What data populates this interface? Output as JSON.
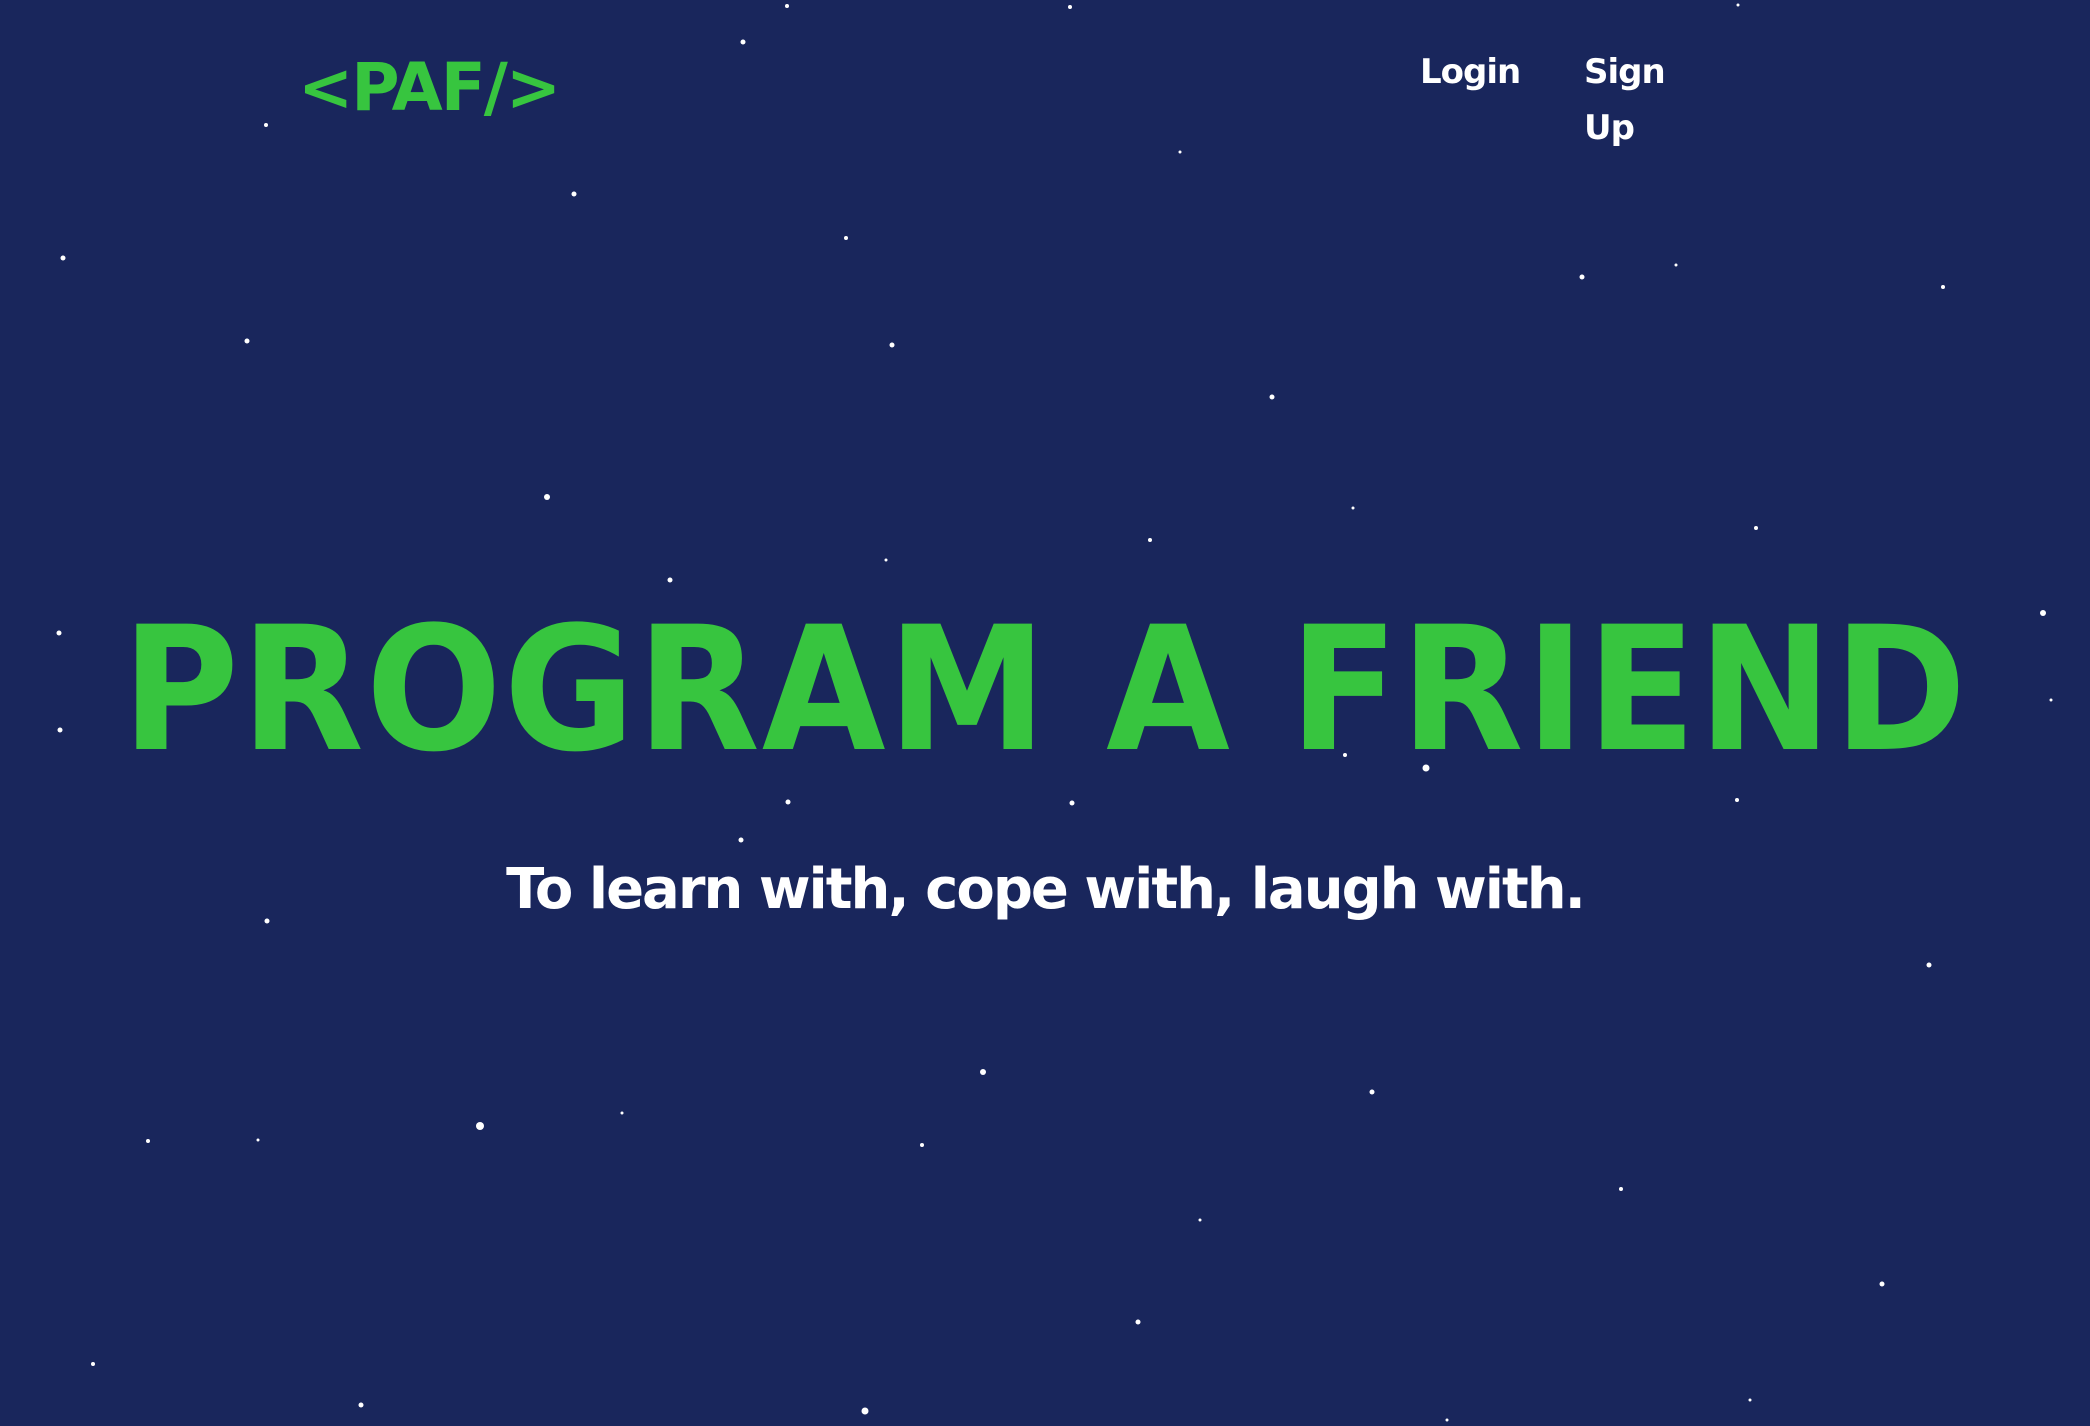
{
  "colors": {
    "background": "#19265c",
    "accent": "#37c53f",
    "text": "#ffffff",
    "star": "#ffffff"
  },
  "header": {
    "logo_text": "<PAF/>",
    "nav": {
      "login_label": "Login",
      "signup_label": "Sign Up"
    }
  },
  "hero": {
    "title": "PROGRAM A FRIEND",
    "subtitle": "To learn with, cope with, laugh with."
  },
  "background": {
    "icon": "starfield"
  }
}
